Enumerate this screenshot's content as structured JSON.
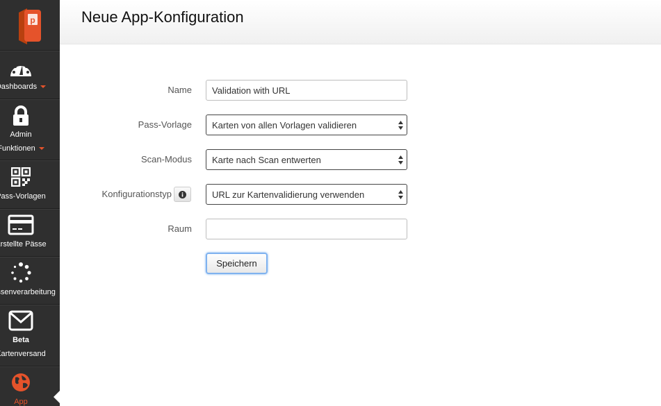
{
  "header": {
    "title": "Neue App-Konfiguration"
  },
  "sidebar": {
    "logo_icon": "passcreator-logo-icon",
    "items": [
      {
        "label": "Dashboards",
        "icon": "speedometer-icon",
        "has_caret": true
      },
      {
        "label_line1": "Admin",
        "label_line2": "Funktionen",
        "icon": "lock-icon",
        "has_caret": true
      },
      {
        "label": "Pass-Vorlagen",
        "icon": "qr-code-icon"
      },
      {
        "label": "Erstellte Pässe",
        "icon": "credit-card-icon"
      },
      {
        "label": "Massenverarbeitung",
        "icon": "spinner-icon"
      },
      {
        "badge": "Beta",
        "label": "Kartenversand",
        "icon": "envelope-icon"
      },
      {
        "label": "App",
        "icon": "globe-icon",
        "active": true
      }
    ]
  },
  "form": {
    "name": {
      "label": "Name",
      "value": "Validation with URL"
    },
    "pass_template": {
      "label": "Pass-Vorlage",
      "selected": "Karten von allen Vorlagen validieren"
    },
    "scan_mode": {
      "label": "Scan-Modus",
      "selected": "Karte nach Scan entwerten"
    },
    "config_type": {
      "label": "Konfigurationstyp",
      "selected": "URL zur Kartenvalidierung verwenden",
      "info_icon": "info-icon"
    },
    "room": {
      "label": "Raum",
      "value": ""
    },
    "save_label": "Speichern"
  },
  "colors": {
    "sidebar_bg": "#2f2f2f",
    "accent": "#e5532b"
  }
}
